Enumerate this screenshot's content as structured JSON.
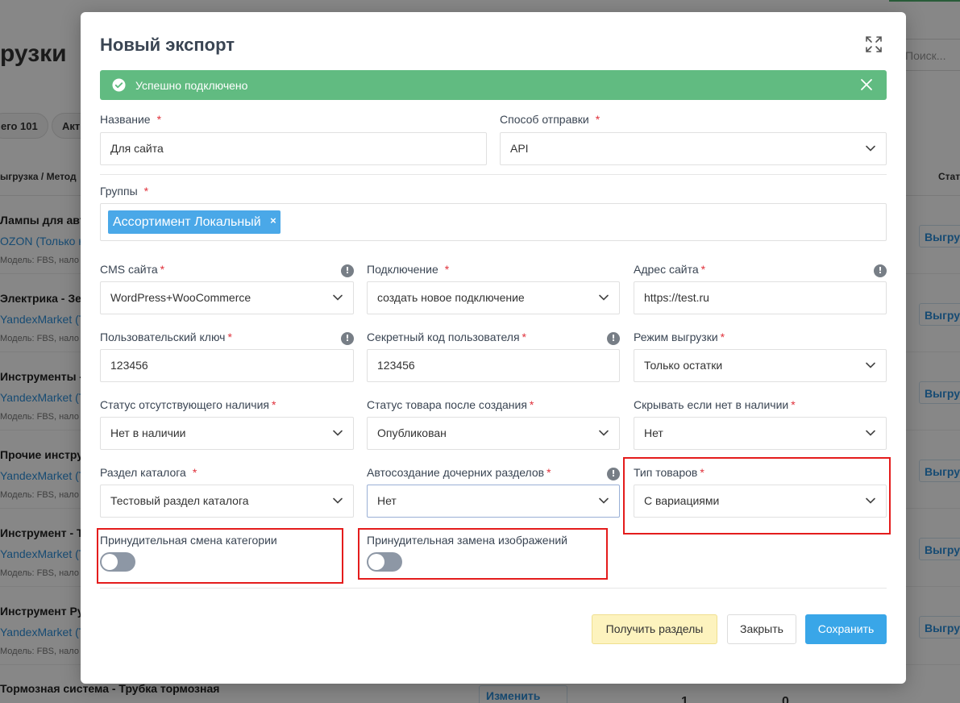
{
  "background": {
    "page_title": "рузки",
    "search_placeholder": "Поиск...",
    "chips": [
      "его 101",
      "Акт"
    ],
    "headers": {
      "col1": "ыгрузка / Метод",
      "col2": "Стат"
    },
    "rows": [
      {
        "title": "Лампы для авто",
        "link": "OZON (Только н",
        "sub": "Модель: FBS, нало",
        "button": "Выгру"
      },
      {
        "title": "Электрика - Зе",
        "link": "YandexMarket (Т",
        "sub": "Модель: FBS, нало",
        "button": "Выгру"
      },
      {
        "title": "Инструменты -",
        "link": "YandexMarket (Т",
        "sub": "Модель: FBS, нало",
        "button": "Выгру"
      },
      {
        "title": "Прочие инстру",
        "link": "YandexMarket (Т",
        "sub": "Модель: FBS, нало",
        "button": "Выгру"
      },
      {
        "title": "Инструмент - Т",
        "link": "YandexMarket (Т",
        "sub": "Модель: FBS, нало",
        "button": "Выгру"
      },
      {
        "title": "Инструмент Ру",
        "link": "YandexMarket (Т",
        "sub": "Модель: FBS, нало",
        "button": "Выгру"
      }
    ],
    "last_row": {
      "title": "Тормозная система - Трубка тормозная",
      "edit_button": "Изменить",
      "count1": "1",
      "count2": "0"
    }
  },
  "modal": {
    "title": "Новый экспорт",
    "alert": {
      "text": "Успешно подключено",
      "color": "#61bb81"
    },
    "fields": {
      "name": {
        "label": "Название",
        "value": "Для сайта"
      },
      "send_method": {
        "label": "Способ отправки",
        "value": "API"
      },
      "groups": {
        "label": "Группы",
        "tags": [
          "Ассортимент Локальный"
        ]
      },
      "cms": {
        "label": "CMS сайта",
        "value": "WordPress+WooCommerce"
      },
      "connection": {
        "label": "Подключение",
        "value": "создать новое подключение"
      },
      "site_address": {
        "label": "Адрес сайта",
        "value": "https://test.ru"
      },
      "user_key": {
        "label": "Пользовательский ключ",
        "value": "123456"
      },
      "user_secret": {
        "label": "Секретный код пользователя",
        "value": "123456"
      },
      "export_mode": {
        "label": "Режим выгрузки",
        "value": "Только остатки"
      },
      "out_of_stock_status": {
        "label": "Статус отсутствующего наличия",
        "value": "Нет в наличии"
      },
      "product_status": {
        "label": "Статус товара после создания",
        "value": "Опубликован"
      },
      "hide_out_of_stock": {
        "label": "Скрывать если нет в наличии",
        "value": "Нет"
      },
      "catalog_section": {
        "label": "Раздел каталога",
        "value": "Тестовый раздел каталога"
      },
      "auto_subsections": {
        "label": "Автосоздание дочерних разделов",
        "value": "Нет"
      },
      "product_type": {
        "label": "Тип товаров",
        "value": "С вариациями"
      },
      "force_category": {
        "label": "Принудительная смена категории",
        "enabled": false
      },
      "force_images": {
        "label": "Принудительная замена изображений",
        "enabled": false
      }
    },
    "buttons": {
      "get_sections": "Получить разделы",
      "close": "Закрыть",
      "save": "Сохранить"
    },
    "info_glyph": "!",
    "tag_remove_glyph": "×",
    "required_mark": "*"
  }
}
